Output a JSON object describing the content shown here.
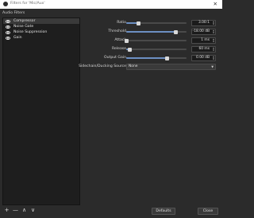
{
  "window": {
    "title": "Filters for 'Mic/Aux'",
    "close_glyph": "✕"
  },
  "section": {
    "label": "Audio Filters"
  },
  "filters": [
    {
      "name": "Compressor",
      "selected": true
    },
    {
      "name": "Noise Gate",
      "selected": false
    },
    {
      "name": "Noise Suppression",
      "selected": false
    },
    {
      "name": "Gain",
      "selected": false
    }
  ],
  "list_toolbar": {
    "add": "+",
    "remove": "—",
    "up": "∧",
    "down": "∨"
  },
  "properties": {
    "ratio": {
      "label": "Ratio",
      "value": "3.00:1",
      "level": 0.2
    },
    "threshold": {
      "label": "Threshold",
      "value": "-18.00 dB",
      "level": 0.82
    },
    "attack": {
      "label": "Attack",
      "value": "1 ms",
      "level": 0.01
    },
    "release": {
      "label": "Release",
      "value": "60 ms",
      "level": 0.06
    },
    "output_gain": {
      "label": "Output Gain",
      "value": "0.00 dB",
      "level": 0.68
    },
    "sidechain": {
      "label": "Sidechain/Ducking Source",
      "value": "None"
    }
  },
  "footer": {
    "defaults": "Defaults",
    "close": "Close"
  },
  "colors": {
    "accent": "#6c8fc2",
    "background": "#2b2b2b",
    "list_bg": "#1e1e1e"
  },
  "icons": {
    "visibility": "eye-icon",
    "window": "app-icon"
  }
}
